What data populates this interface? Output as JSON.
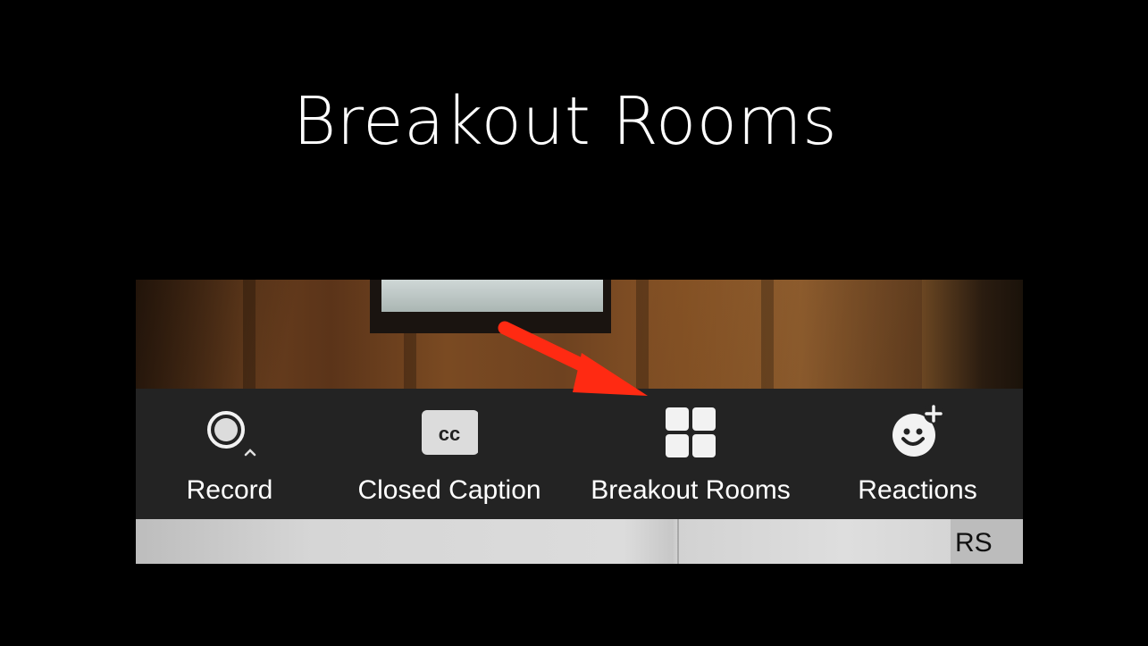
{
  "slide": {
    "title": "Breakout Rooms"
  },
  "toolbar": {
    "items": [
      {
        "label": "Record",
        "icon": "record-icon"
      },
      {
        "label": "Closed Caption",
        "icon": "closed-caption-icon",
        "icon_text": "cc"
      },
      {
        "label": "Breakout Rooms",
        "icon": "breakout-rooms-icon"
      },
      {
        "label": "Reactions",
        "icon": "reactions-icon"
      }
    ]
  },
  "participant": {
    "initials": "RS"
  },
  "colors": {
    "slide_background": "#000000",
    "toolbar_background": "#232323",
    "toolbar_text": "#ffffff",
    "arrow": "#ff2a12",
    "cc_badge": "#d9d9d9"
  }
}
